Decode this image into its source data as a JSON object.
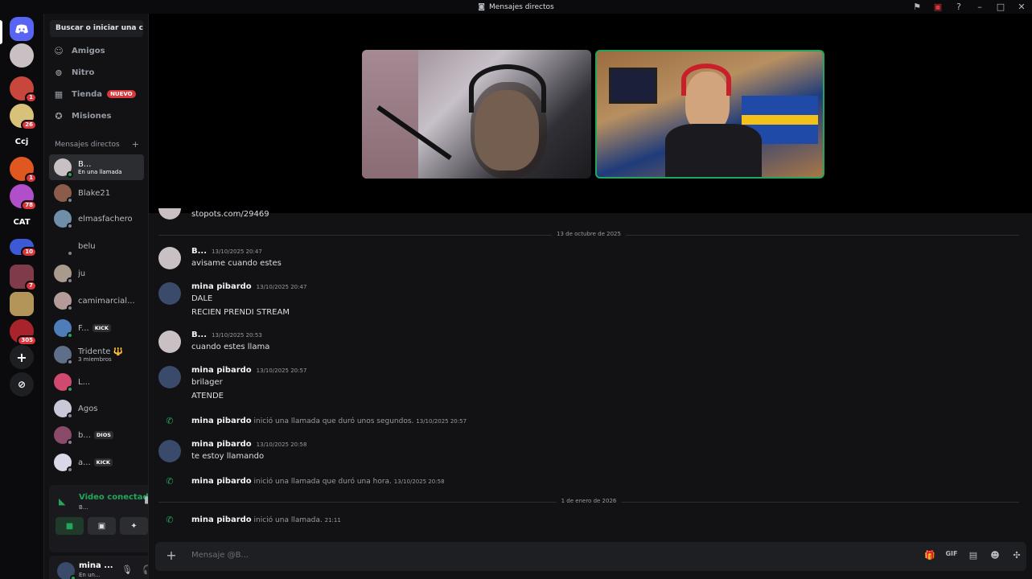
{
  "window": {
    "title": "Mensajes directos"
  },
  "servers": [
    {
      "label": "",
      "color": "#5865f2",
      "badge": ""
    },
    {
      "label": "",
      "color": "#c9c0c4",
      "badge": ""
    },
    {
      "label": "",
      "color": "#c7473c",
      "badge": "1"
    },
    {
      "label": "",
      "color": "#d8c27a",
      "badge": "26"
    },
    {
      "label": "Ccj",
      "color": "#0b0b0d",
      "badge": ""
    },
    {
      "label": "",
      "color": "#e0581f",
      "badge": "1"
    },
    {
      "label": "",
      "color": "#b04fc9",
      "badge": "78"
    },
    {
      "label": "CAT",
      "color": "#0b0b0d",
      "badge": ""
    },
    {
      "label": "",
      "color": "#3c59d6",
      "badge": "10"
    },
    {
      "label": "",
      "color": "#7f3b4a",
      "badge": "7"
    },
    {
      "label": "",
      "color": "#b3955a",
      "badge": ""
    },
    {
      "label": "",
      "color": "#a8232c",
      "badge": "305"
    }
  ],
  "sidebar": {
    "search_placeholder": "Buscar o iniciar una co...",
    "nav": [
      {
        "label": "Amigos",
        "icon": "friends-icon"
      },
      {
        "label": "Nitro",
        "icon": "nitro-icon"
      },
      {
        "label": "Tienda",
        "icon": "shop-icon",
        "badge": "NUEVO"
      },
      {
        "label": "Misiones",
        "icon": "quests-icon"
      }
    ],
    "dm_header": "Mensajes directos",
    "dms": [
      {
        "name": "B...",
        "sub": "En una llamada",
        "avatar": "#c9c0c4",
        "online": true,
        "active": true
      },
      {
        "name": "Blake21",
        "sub": "",
        "avatar": "#8c5b4a",
        "online": false
      },
      {
        "name": "elmasfachero",
        "sub": "",
        "avatar": "#6f8fa8",
        "online": false
      },
      {
        "name": "belu",
        "sub": "",
        "avatar": "#121214",
        "online": false
      },
      {
        "name": "ju",
        "sub": "",
        "avatar": "#a89a8c",
        "online": false
      },
      {
        "name": "camimarcial...",
        "sub": "",
        "avatar": "#b59a9a",
        "online": false
      },
      {
        "name": "F...",
        "sub": "",
        "avatar": "#4f7dba",
        "online": true,
        "tag": "KICK"
      },
      {
        "name": "Tridente 🔱",
        "sub": "3 miembros",
        "avatar": "#5f6f8a",
        "online": false
      },
      {
        "name": "L...",
        "sub": "",
        "avatar": "#d04a6f",
        "online": true
      },
      {
        "name": "Agos",
        "sub": "",
        "avatar": "#c8c8d8",
        "online": false
      },
      {
        "name": "b...",
        "sub": "",
        "avatar": "#8a4a6a",
        "online": false,
        "tag": "DIOS"
      },
      {
        "name": "a...",
        "sub": "",
        "avatar": "#d8d8e8",
        "online": false,
        "tag": "KICK"
      }
    ]
  },
  "voice": {
    "status": "Video conectad",
    "channel": "B...",
    "buttons": [
      "camera-button",
      "screenshare-button",
      "activities-button",
      "soundboard-button"
    ]
  },
  "user": {
    "name": "mina ...",
    "status": "En un..."
  },
  "chat": {
    "partial_link": "stopots.com/29469",
    "date1": "13 de octubre de 2025",
    "messages": [
      {
        "author": "B...",
        "time": "13/10/2025 20:47",
        "lines": [
          "avisame cuando estes"
        ],
        "avatar": "#c9c0c4"
      },
      {
        "author": "mina pibardo",
        "time": "13/10/2025 20:47",
        "lines": [
          "DALE",
          "RECIEN PRENDI STREAM"
        ],
        "avatar": "#3a4a6a"
      },
      {
        "author": "B...",
        "time": "13/10/2025 20:53",
        "lines": [
          "cuando estes llama"
        ],
        "avatar": "#c9c0c4"
      },
      {
        "author": "mina pibardo",
        "time": "13/10/2025 20:57",
        "lines": [
          "brilager",
          "ATENDE"
        ],
        "avatar": "#3a4a6a"
      }
    ],
    "call1": {
      "author": "mina pibardo",
      "text": "inició una llamada que duró unos segundos.",
      "time": "13/10/2025 20:57"
    },
    "message5": {
      "author": "mina pibardo",
      "time": "13/10/2025 20:58",
      "line": "te estoy llamando"
    },
    "call2": {
      "author": "mina pibardo",
      "text": "inició una llamada que duró una hora.",
      "time": "13/10/2025 20:58"
    },
    "date2": "1 de enero de 2026",
    "call3": {
      "author": "mina pibardo",
      "text": "inició una llamada.",
      "time": "21:11"
    }
  },
  "composer": {
    "placeholder": "Mensaje @B..."
  },
  "colors": {
    "accent": "#5865f2",
    "online": "#23a55a",
    "danger": "#da373c"
  }
}
